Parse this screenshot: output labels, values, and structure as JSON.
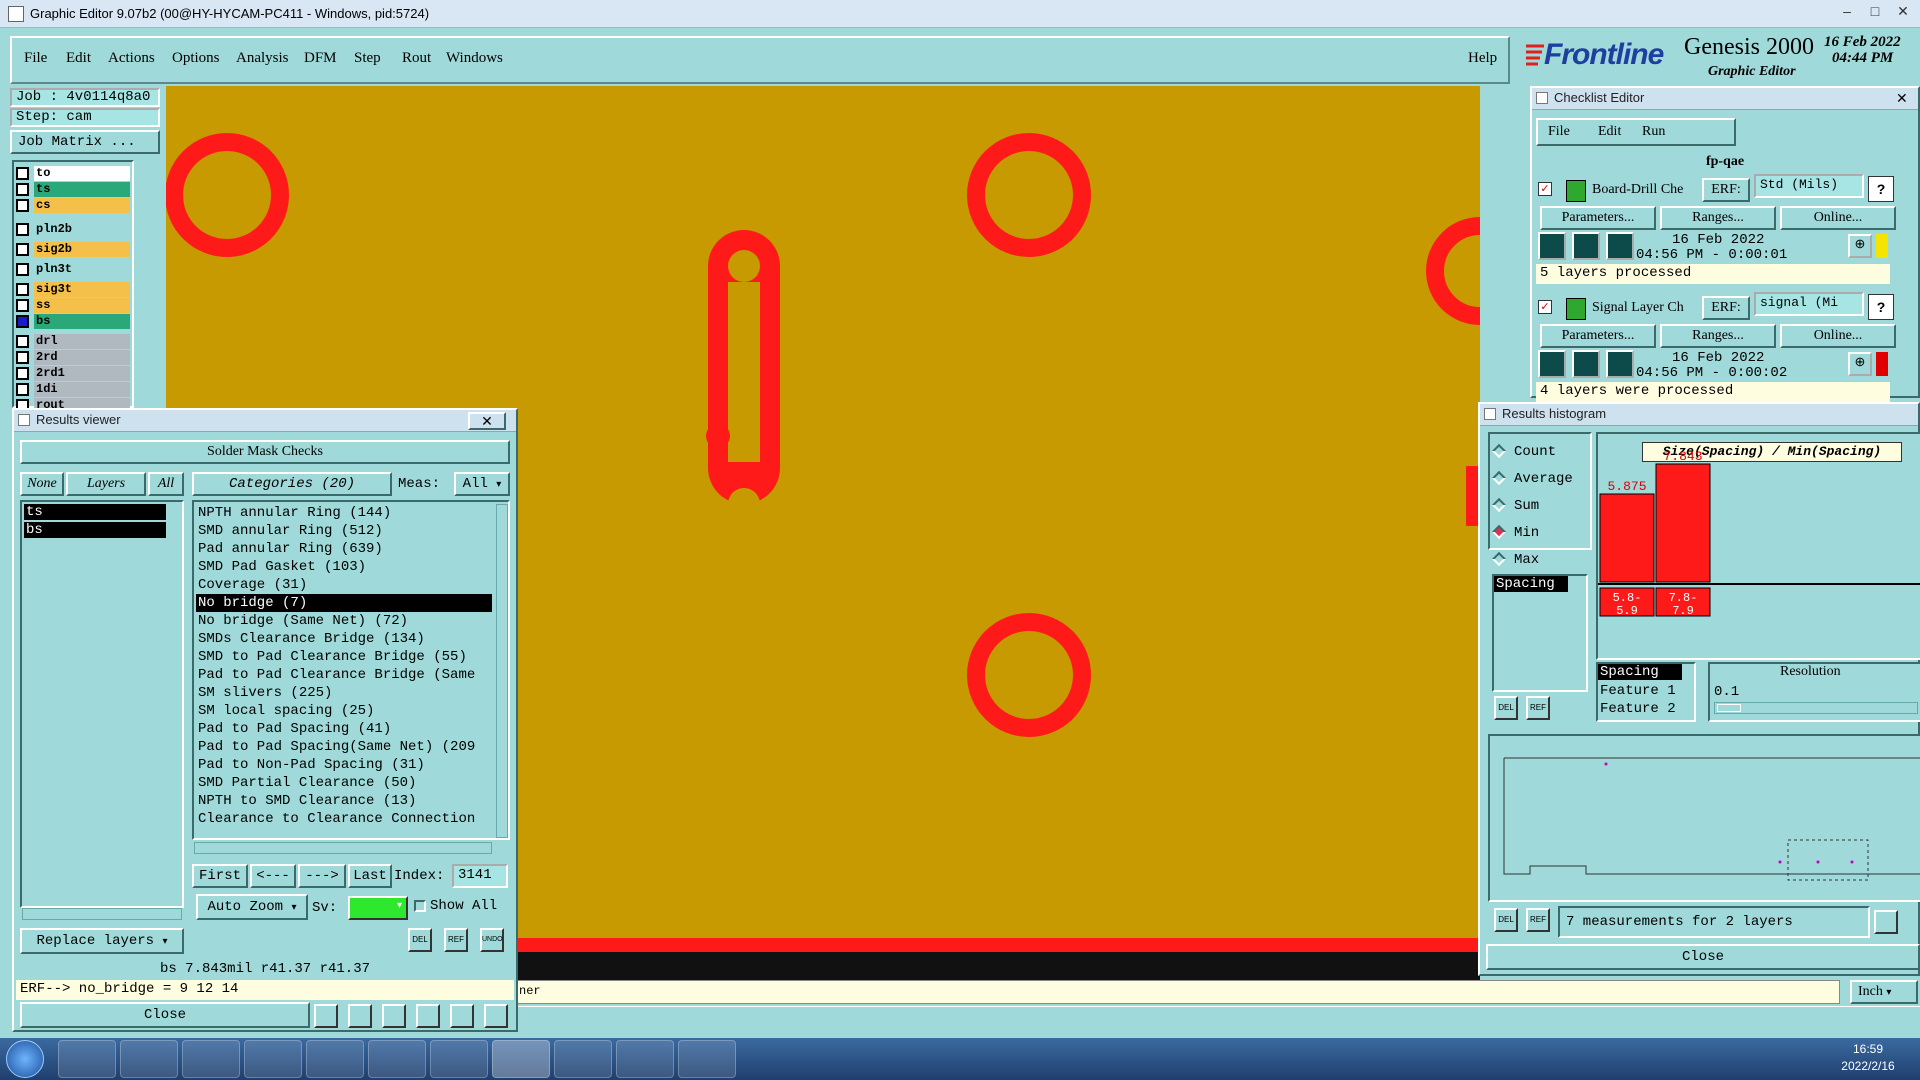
{
  "window": {
    "title": "Graphic Editor 9.07b2 (00@HY-HYCAM-PC411 - Windows, pid:5724)"
  },
  "menu": {
    "items": [
      "File",
      "Edit",
      "Actions",
      "Options",
      "Analysis",
      "DFM",
      "Step",
      "Rout",
      "Windows"
    ],
    "help": "Help"
  },
  "brand": {
    "logo": "Frontline",
    "product": "Genesis 2000",
    "subtitle": "Graphic Editor",
    "date": "16 Feb 2022",
    "time": "04:44 PM"
  },
  "job": {
    "job_label": "Job : 4v0114q8a0",
    "step_label": "Step: cam",
    "matrix_button": "Job Matrix ..."
  },
  "layers": [
    {
      "name": "to",
      "color": "#ffffff"
    },
    {
      "name": "ts",
      "color": "#2aa87a"
    },
    {
      "name": "cs",
      "color": "#f5c04a"
    },
    {
      "name": "pln2b",
      "color": "#9fd9d9"
    },
    {
      "name": "sig2b",
      "color": "#f5c04a"
    },
    {
      "name": "pln3t",
      "color": "#9fd9d9"
    },
    {
      "name": "sig3t",
      "color": "#f5c04a"
    },
    {
      "name": "ss",
      "color": "#f5c04a"
    },
    {
      "name": "bs",
      "color": "#2aa87a"
    },
    {
      "name": "drl",
      "color": "#b0b8c0"
    },
    {
      "name": "2rd",
      "color": "#b0b8c0"
    },
    {
      "name": "2rd1",
      "color": "#b0b8c0"
    },
    {
      "name": "1di",
      "color": "#b0b8c0"
    },
    {
      "name": "rout",
      "color": "#b0b8c0"
    }
  ],
  "results_viewer": {
    "title": "Results viewer",
    "header": "Solder Mask Checks",
    "none_btn": "None",
    "layers_btn": "Layers",
    "all_btn": "All",
    "categories_label": "Categories (20)",
    "meas_label": "Meas:",
    "meas_value": "All",
    "selected_layers": [
      "ts",
      "bs"
    ],
    "categories": [
      "NPTH annular Ring (144)",
      "SMD annular Ring (512)",
      "Pad annular Ring (639)",
      "SMD Pad Gasket (103)",
      "Coverage (31)",
      "No bridge (7)",
      "No bridge (Same Net) (72)",
      "SMDs Clearance Bridge (134)",
      "SMD to Pad Clearance Bridge (55)",
      "Pad to Pad Clearance Bridge (Same",
      "SM slivers (225)",
      "SM local spacing (25)",
      "Pad to Pad Spacing (41)",
      "Pad to Pad Spacing(Same Net) (209",
      "Pad to Non-Pad Spacing (31)",
      "SMD Partial Clearance (50)",
      "NPTH to SMD Clearance (13)",
      "Clearance to Clearance Connection"
    ],
    "selected_index": 5,
    "first_btn": "First",
    "prev_btn": "<---",
    "next_btn": "--->",
    "last_btn": "Last",
    "index_label": "Index:",
    "index_value": "3141",
    "zoom_label": "Auto Zoom",
    "sv_label": "Sv:",
    "show_all": "Show All",
    "replace_label": "Replace layers",
    "status": "bs 7.843mil  r41.37  r41.37",
    "erf": "ERF--> no_bridge = 9 12 14",
    "close": "Close",
    "del": "DEL",
    "ref": "REF",
    "undo": "UNDO"
  },
  "checklist": {
    "title": "Checklist Editor",
    "menu": [
      "File",
      "Edit",
      "Run"
    ],
    "name": "fp-qae",
    "checks": [
      {
        "name": "Board-Drill Che",
        "erf_label": "ERF:",
        "erf_value": "Std (Mils)",
        "params": "Parameters...",
        "ranges": "Ranges...",
        "online": "Online...",
        "date": "16 Feb 2022",
        "time": "04:56 PM - 0:00:01",
        "status": "5 layers processed",
        "flag_color": "#f5e400"
      },
      {
        "name": "Signal Layer Ch",
        "erf_label": "ERF:",
        "erf_value": "signal (Mi",
        "params": "Parameters...",
        "ranges": "Ranges...",
        "online": "Online...",
        "date": "16 Feb 2022",
        "time": "04:56 PM - 0:00:02",
        "status": "4 layers were processed",
        "flag_color": "#e00000"
      }
    ]
  },
  "histogram": {
    "title": "Results histogram",
    "options": [
      "Count",
      "Average",
      "Sum",
      "Min",
      "Max"
    ],
    "selected_option": "Min",
    "list_item": "Spacing",
    "chart_title": "Size(Spacing) / Min(Spacing)",
    "resolution_label": "Resolution",
    "resolution_value": "0.1",
    "meas_list": [
      "Spacing",
      "Feature 1",
      "Feature 2"
    ],
    "measurements": "7 measurements for 2 layers",
    "close": "Close",
    "del": "DEL",
    "ref": "REF"
  },
  "chart_data": {
    "type": "bar",
    "categories": [
      "5.8-5.9",
      "7.8-7.9"
    ],
    "values": [
      5.875,
      7.843
    ],
    "title": "Size(Spacing) / Min(Spacing)",
    "ylim": [
      0,
      8
    ]
  },
  "statusbar": {
    "message": "ner",
    "units": "Inch"
  },
  "taskbar": {
    "time": "16:59",
    "date": "2022/2/16"
  },
  "colors": {
    "board": "#c69a00",
    "pad": "#ff1a1a",
    "panel": "#9fd9d9",
    "selection": "#000000"
  }
}
